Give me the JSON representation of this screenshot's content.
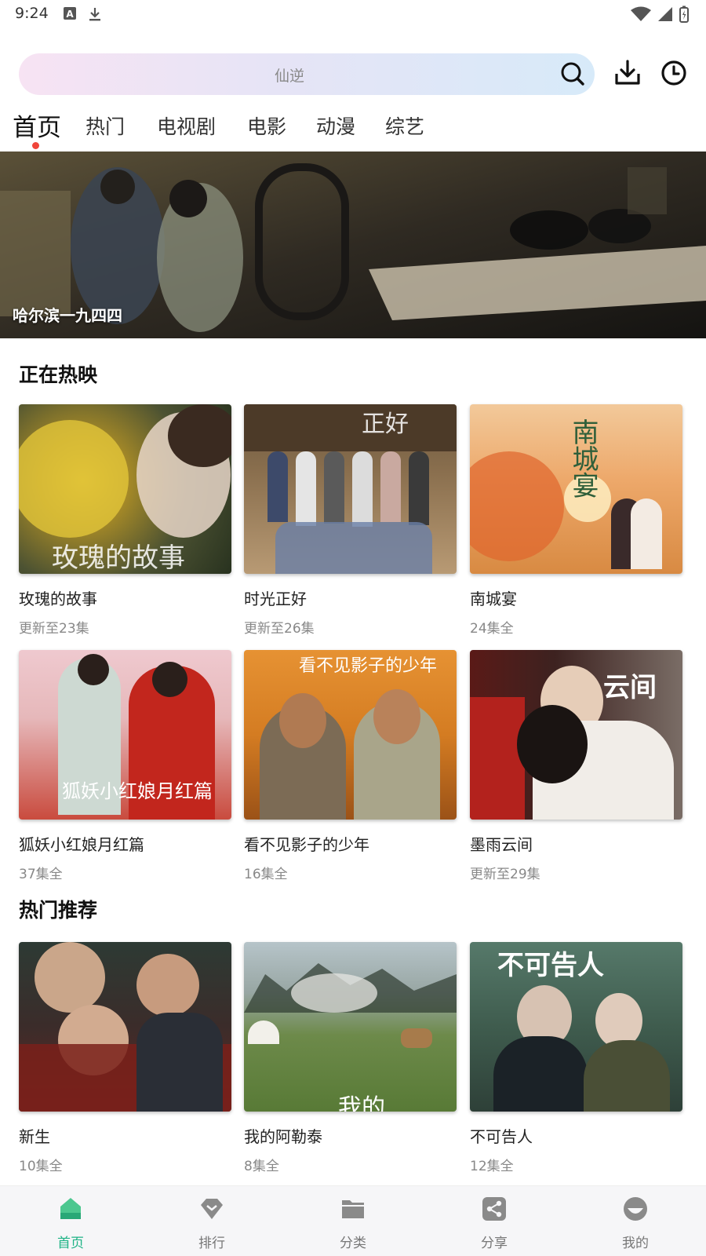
{
  "status_bar": {
    "time": "9:24"
  },
  "search": {
    "placeholder": "仙逆"
  },
  "tabs": [
    {
      "label": "首页",
      "active": true
    },
    {
      "label": "热门"
    },
    {
      "label": "电视剧"
    },
    {
      "label": "电影"
    },
    {
      "label": "动漫"
    },
    {
      "label": "综艺"
    }
  ],
  "banner": {
    "title": "哈尔滨一九四四"
  },
  "sections": [
    {
      "title": "正在热映",
      "items": [
        {
          "title": "玫瑰的故事",
          "subtitle": "更新至23集",
          "poster_text": "玫瑰的故事"
        },
        {
          "title": "时光正好",
          "subtitle": "更新至26集",
          "poster_text": "正好"
        },
        {
          "title": "南城宴",
          "subtitle": "24集全",
          "poster_text": "南城宴"
        },
        {
          "title": "狐妖小红娘月红篇",
          "subtitle": "37集全",
          "poster_text": "狐妖小红娘月红篇"
        },
        {
          "title": "看不见影子的少年",
          "subtitle": "16集全",
          "poster_text": "看不见影子的少年"
        },
        {
          "title": "墨雨云间",
          "subtitle": "更新至29集",
          "poster_text": "云间"
        }
      ]
    },
    {
      "title": "热门推荐",
      "items": [
        {
          "title": "新生",
          "subtitle": "10集全",
          "poster_text": ""
        },
        {
          "title": "我的阿勒泰",
          "subtitle": "8集全",
          "poster_text": "我的"
        },
        {
          "title": "不可告人",
          "subtitle": "12集全",
          "poster_text": "不可告人"
        }
      ]
    }
  ],
  "bottom_nav": [
    {
      "label": "首页",
      "icon": "home-icon",
      "active": true
    },
    {
      "label": "排行",
      "icon": "ranking-icon"
    },
    {
      "label": "分类",
      "icon": "category-folder-icon"
    },
    {
      "label": "分享",
      "icon": "share-icon"
    },
    {
      "label": "我的",
      "icon": "profile-icon"
    }
  ],
  "colors": {
    "accent": "#1fb386",
    "tab_indicator": "#f0453a"
  }
}
